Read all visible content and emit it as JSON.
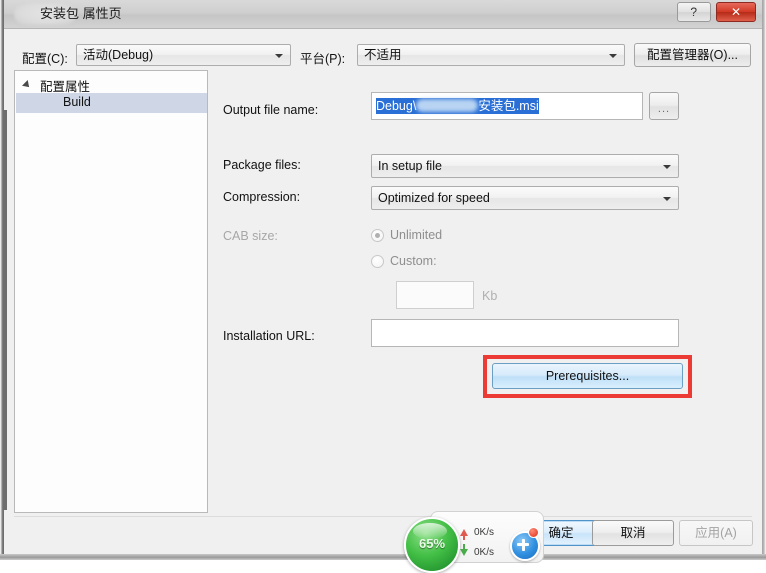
{
  "window": {
    "title": "安装包 属性页",
    "help_button": "?",
    "close_button": "✕"
  },
  "config_bar": {
    "configuration_label": "配置(C):",
    "configuration_value": "活动(Debug)",
    "platform_label": "平台(P):",
    "platform_value": "不适用",
    "config_manager_button": "配置管理器(O)..."
  },
  "tree": {
    "root_label": "配置属性",
    "child_label": "Build"
  },
  "form": {
    "output_file_name": {
      "label": "Output file name:",
      "value_prefix": "Debug\\",
      "value_suffix": "安装包.msi",
      "browse_button": "..."
    },
    "package_files": {
      "label": "Package files:",
      "value": "In setup file"
    },
    "compression": {
      "label": "Compression:",
      "value": "Optimized for speed"
    },
    "cab_size": {
      "label": "CAB size:",
      "unlimited_label": "Unlimited",
      "custom_label": "Custom:",
      "custom_value": "",
      "unit_label": "Kb"
    },
    "installation_url": {
      "label": "Installation URL:",
      "value": ""
    },
    "prerequisites_button": "Prerequisites..."
  },
  "footer": {
    "ok_button": "确定",
    "cancel_button": "取消",
    "apply_button": "应用(A)"
  },
  "speed_widget": {
    "percent": "65%",
    "upload_speed": "0K/s",
    "download_speed": "0K/s"
  },
  "colors": {
    "accent_red": "#ec3a35",
    "selection_blue": "#2a6fd6",
    "gauge_green": "#43bf46",
    "close_red": "#d23a26"
  }
}
